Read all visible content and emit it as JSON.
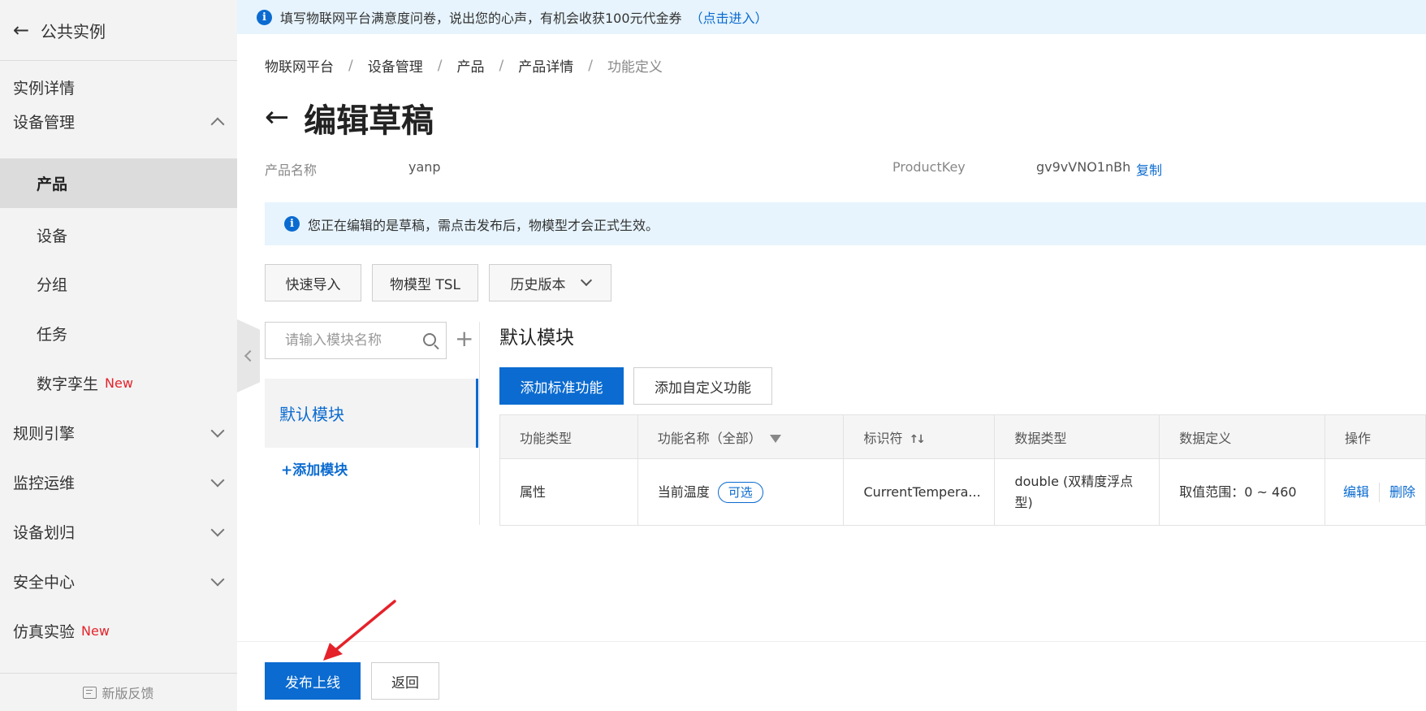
{
  "sidebar": {
    "back_label": "公共实例",
    "items": [
      {
        "label": "实例详情"
      },
      {
        "label": "设备管理"
      },
      {
        "label": "产品"
      },
      {
        "label": "设备"
      },
      {
        "label": "分组"
      },
      {
        "label": "任务"
      },
      {
        "label": "数字孪生",
        "badge": "New"
      },
      {
        "label": "规则引擎"
      },
      {
        "label": "监控运维"
      },
      {
        "label": "设备划归"
      },
      {
        "label": "安全中心"
      },
      {
        "label": "仿真实验",
        "badge": "New"
      }
    ],
    "feedback_label": "新版反馈"
  },
  "banner": {
    "text": "填写物联网平台满意度问卷，说出您的心声，有机会收获100元代金券",
    "link": "（点击进入）"
  },
  "breadcrumb": [
    "物联网平台",
    "设备管理",
    "产品",
    "产品详情",
    "功能定义"
  ],
  "page": {
    "title": "编辑草稿",
    "product_name_label": "产品名称",
    "product_name_value": "yanp",
    "product_key_label": "ProductKey",
    "product_key_value": "gv9vVNO1nBh",
    "copy_label": "复制"
  },
  "notice": {
    "text": "您正在编辑的是草稿，需点击发布后，物模型才会正式生效。"
  },
  "toolbar": {
    "quick_import": "快速导入",
    "tsl": "物模型 TSL",
    "history": "历史版本"
  },
  "modules": {
    "search_placeholder": "请输入模块名称",
    "items": [
      "默认模块"
    ],
    "add_label": "+添加模块"
  },
  "module_panel": {
    "title": "默认模块",
    "add_standard": "添加标准功能",
    "add_custom": "添加自定义功能"
  },
  "table": {
    "headers": [
      "功能类型",
      "功能名称（全部）",
      "标识符",
      "数据类型",
      "数据定义",
      "操作"
    ],
    "rows": [
      {
        "type": "属性",
        "name": "当前温度",
        "tag": "可选",
        "identifier": "CurrentTempera...",
        "data_type": "double (双精度浮点型)",
        "definition": "取值范围：0 ~ 460",
        "edit": "编辑",
        "delete": "删除"
      }
    ]
  },
  "footer": {
    "publish": "发布上线",
    "back": "返回"
  },
  "colors": {
    "accent": "#0b6bd0",
    "annotation_arrow": "#e5222a",
    "new_badge": "#e5222a"
  }
}
